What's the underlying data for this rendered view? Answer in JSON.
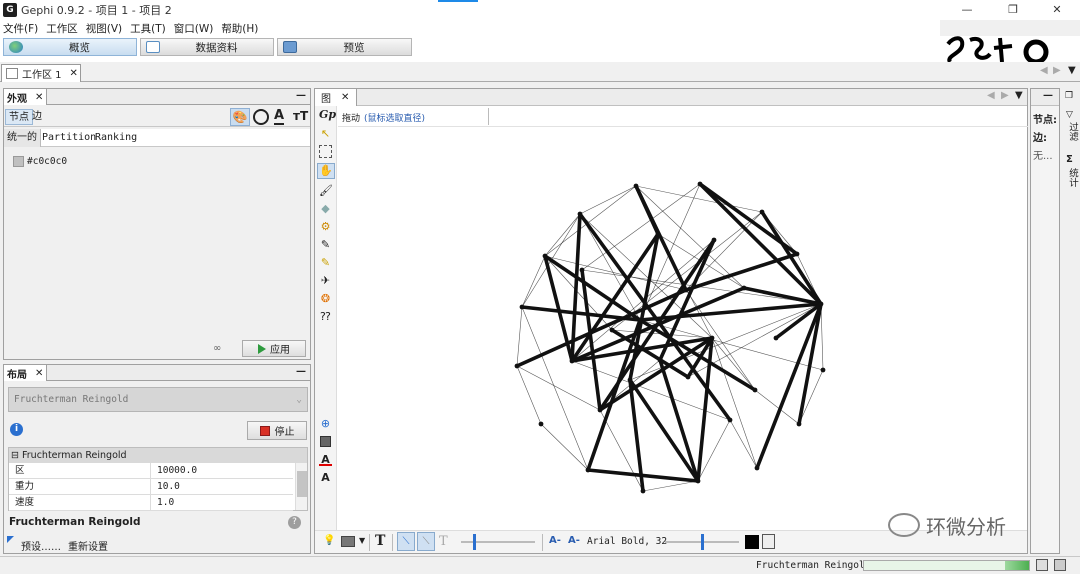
{
  "window": {
    "title": "Gephi 0.9.2 - 项目 1 - 项目 2",
    "app_icon": "gephi-logo-icon",
    "controls": [
      "—",
      "❐",
      "✕"
    ]
  },
  "menu": [
    "文件(F)",
    "工作区",
    "视图(V)",
    "工具(T)",
    "窗口(W)",
    "帮助(H)"
  ],
  "modes": [
    {
      "label": "概览",
      "active": true
    },
    {
      "label": "数据资料",
      "active": false
    },
    {
      "label": "预览",
      "active": false
    }
  ],
  "workspace_tab": {
    "label": "工作区 1",
    "close": "✕"
  },
  "appearance": {
    "panel_title": "外观",
    "close": "✕",
    "minimize": "—",
    "node_tab": "节点",
    "edge_tab": "边",
    "mode_tabs": [
      "统一的",
      "Partition",
      "Ranking"
    ],
    "color_value": "#c0c0c0",
    "swatch_color": "#c0c0c0",
    "link_glyph": "∞",
    "apply_label": "应用",
    "tool_icons": [
      "palette-icon",
      "size-icon",
      "label-color-icon",
      "label-size-icon"
    ]
  },
  "layout_panel": {
    "panel_title": "布局",
    "close": "✕",
    "minimize": "—",
    "algorithm": "Fruchterman Reingold",
    "stop_label": "停止",
    "section": "Fruchterman Reingold",
    "properties": [
      {
        "name": "区",
        "value": "10000.0"
      },
      {
        "name": "重力",
        "value": "10.0"
      },
      {
        "name": "速度",
        "value": "1.0"
      }
    ],
    "description_title": "Fruchterman Reingold",
    "presets_label": "预设……",
    "reset_label": "重新设置"
  },
  "graph_panel": {
    "tab": "图",
    "close": "✕",
    "drag_label": "拖动",
    "drag_hint": "(鼠标选取直径)",
    "font_label": "Arial Bold, 32"
  },
  "right_panel": {
    "lines": [
      "节点:",
      "边:",
      "无..."
    ],
    "minimize": "—",
    "side_tabs": [
      "过滤",
      "统计"
    ]
  },
  "status": {
    "algorithm": "Fruchterman Reingold"
  },
  "watermark": "环微分析",
  "colors": {
    "accent_blue": "#1e8ae8",
    "stop_red": "#d93025",
    "apply_green": "#2e9b3e",
    "progress_green": "#4caf50",
    "edge_color": "#111111"
  }
}
